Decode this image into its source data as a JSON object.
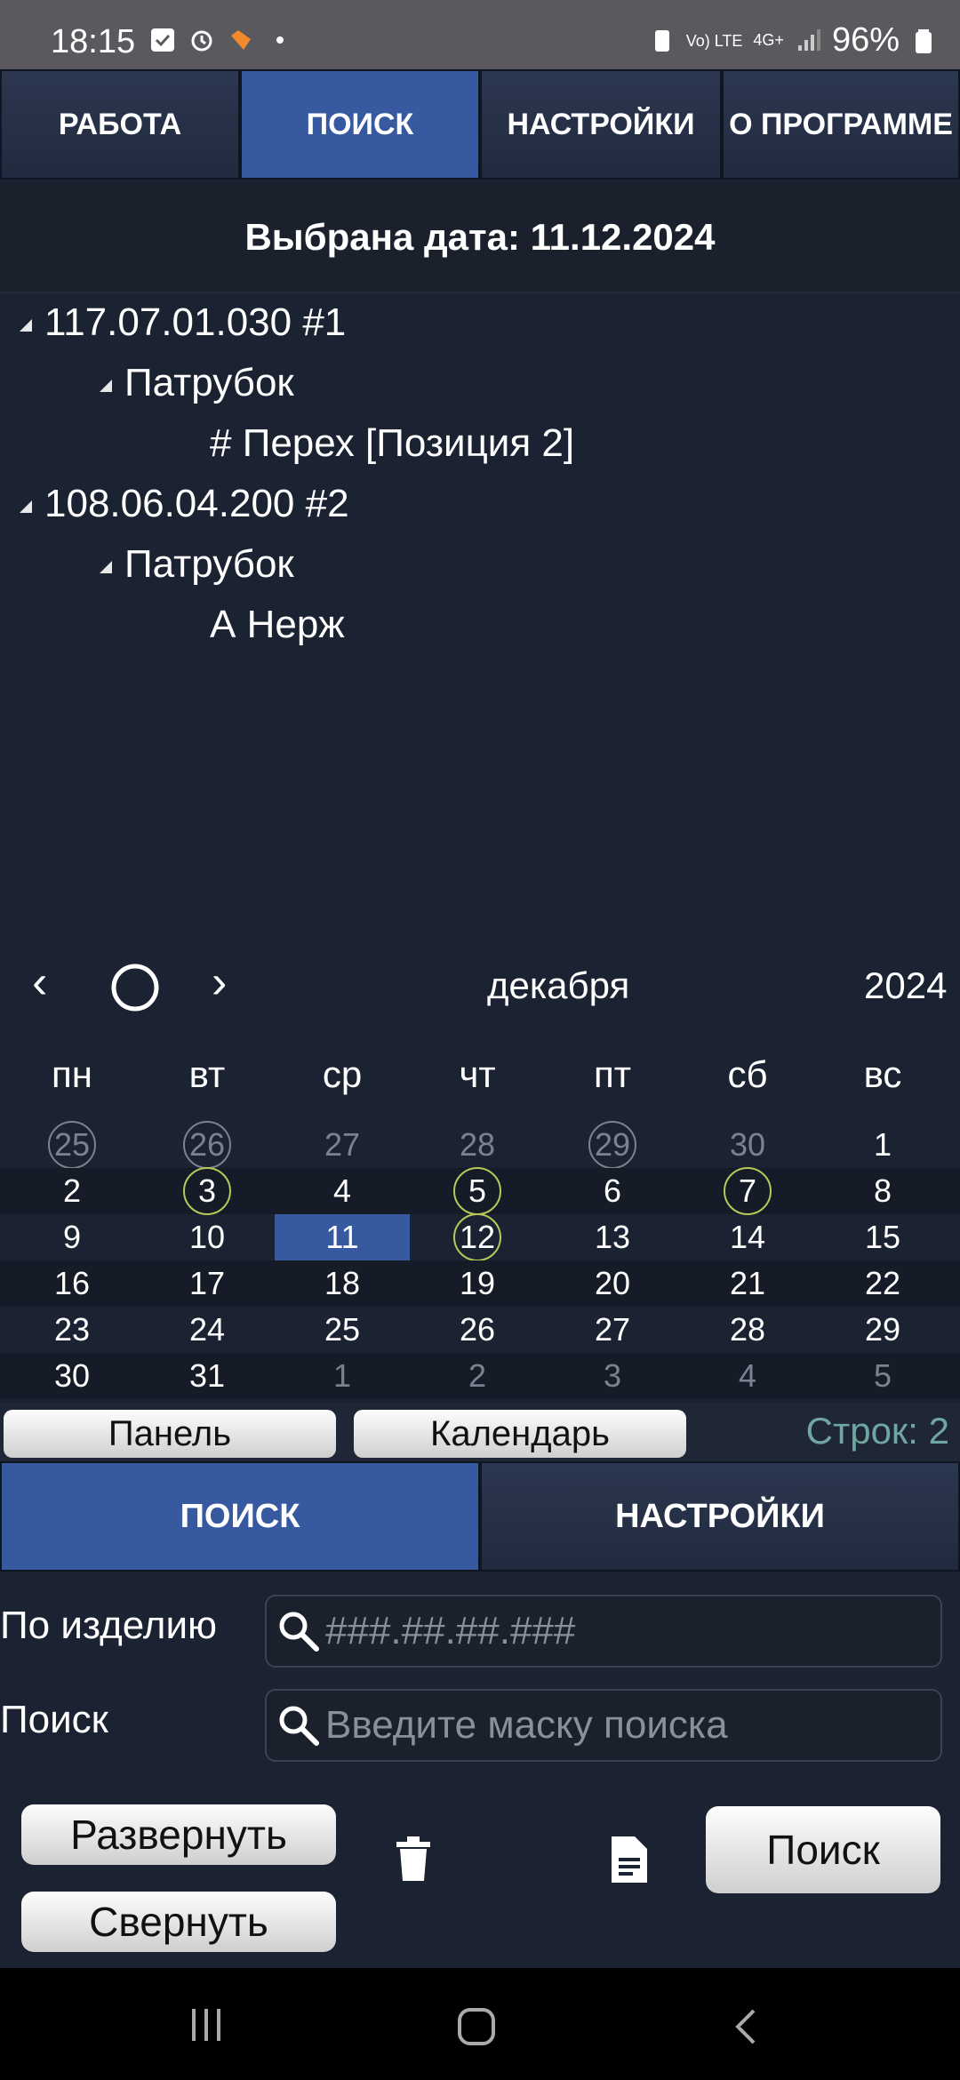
{
  "status_bar": {
    "time": "18:15",
    "battery": "96%",
    "network": "4G+",
    "volte": "Vo) LTE"
  },
  "top_tabs": [
    {
      "label": "РАБОТА",
      "active": false
    },
    {
      "label": "ПОИСК",
      "active": true
    },
    {
      "label": "НАСТРОЙКИ",
      "active": false
    },
    {
      "label": "О ПРОГРАММЕ",
      "active": false
    }
  ],
  "header": {
    "selected_date": "Выбрана дата: 11.12.2024"
  },
  "tree": [
    {
      "label": "117.07.01.030 #1",
      "level": 0,
      "expanded": true
    },
    {
      "label": "Патрубок",
      "level": 1,
      "expanded": true
    },
    {
      "label": "# Перех [Позиция 2]",
      "level": 2
    },
    {
      "label": "108.06.04.200 #2",
      "level": 0,
      "expanded": true
    },
    {
      "label": "Патрубок",
      "level": 1,
      "expanded": true
    },
    {
      "label": "А Нерж",
      "level": 2
    }
  ],
  "calendar": {
    "prev": "‹",
    "next": "›",
    "month": "декабря",
    "year": "2024",
    "weekdays": [
      "пн",
      "вт",
      "ср",
      "чт",
      "пт",
      "сб",
      "вс"
    ],
    "weeks": [
      [
        "25",
        "26",
        "27",
        "28",
        "29",
        "30",
        "1"
      ],
      [
        "2",
        "3",
        "4",
        "5",
        "6",
        "7",
        "8"
      ],
      [
        "9",
        "10",
        "11",
        "12",
        "13",
        "14",
        "15"
      ],
      [
        "16",
        "17",
        "18",
        "19",
        "20",
        "21",
        "22"
      ],
      [
        "23",
        "24",
        "25",
        "26",
        "27",
        "28",
        "29"
      ],
      [
        "30",
        "31",
        "1",
        "2",
        "3",
        "4",
        "5"
      ]
    ],
    "selected": "11",
    "marked": [
      "25",
      "26",
      "29",
      "3",
      "5",
      "7",
      "12"
    ]
  },
  "panel_buttons": {
    "panel": "Панель",
    "calendar": "Календарь",
    "rows": "Строк: 2"
  },
  "bottom_tabs": [
    {
      "label": "ПОИСК",
      "active": true
    },
    {
      "label": "НАСТРОЙКИ",
      "active": false
    }
  ],
  "form": {
    "product_label": "По изделию",
    "product_placeholder": "###.##.##.###",
    "search_label": "Поиск",
    "search_placeholder": "Введите маску поиска"
  },
  "actions": {
    "expand": "Развернуть",
    "collapse": "Свернуть",
    "search": "Поиск"
  },
  "colors": {
    "accent": "#3659a0",
    "background": "#1b2232",
    "ring": "#b8c95a",
    "rows_text": "#6fa6a0"
  }
}
